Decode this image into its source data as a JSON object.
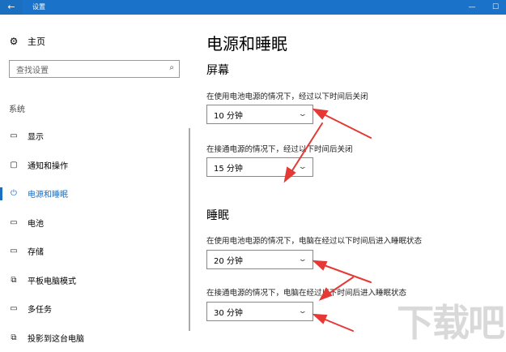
{
  "window": {
    "title": "设置",
    "back_icon": "←",
    "minimize_icon": "—",
    "maximize_icon": "☐"
  },
  "sidebar": {
    "home": {
      "icon": "⚙",
      "label": "主页"
    },
    "search": {
      "placeholder": "查找设置",
      "icon": "⌕"
    },
    "section": "系统",
    "items": [
      {
        "icon": "▭",
        "label": "显示"
      },
      {
        "icon": "▢",
        "label": "通知和操作"
      },
      {
        "icon": "⏻",
        "label": "电源和睡眠",
        "active": true
      },
      {
        "icon": "▭",
        "label": "电池"
      },
      {
        "icon": "▭",
        "label": "存储"
      },
      {
        "icon": "⧉",
        "label": "平板电脑模式"
      },
      {
        "icon": "▭",
        "label": "多任务"
      },
      {
        "icon": "⧉",
        "label": "投影到这台电脑"
      }
    ]
  },
  "main": {
    "title": "电源和睡眠",
    "screen": {
      "title": "屏幕",
      "battery_label": "在使用电池电源的情况下，经过以下时间后关闭",
      "battery_value": "10 分钟",
      "plugged_label": "在接通电源的情况下，经过以下时间后关闭",
      "plugged_value": "15 分钟"
    },
    "sleep": {
      "title": "睡眠",
      "battery_label": "在使用电池电源的情况下，电脑在经过以下时间后进入睡眠状态",
      "battery_value": "20 分钟",
      "plugged_label": "在接通电源的情况下，电脑在经过以下时间后进入睡眠状态",
      "plugged_value": "30 分钟"
    }
  },
  "accent_color": "#1a6fc1",
  "annotation_color": "#e53935",
  "watermark": "下载吧"
}
